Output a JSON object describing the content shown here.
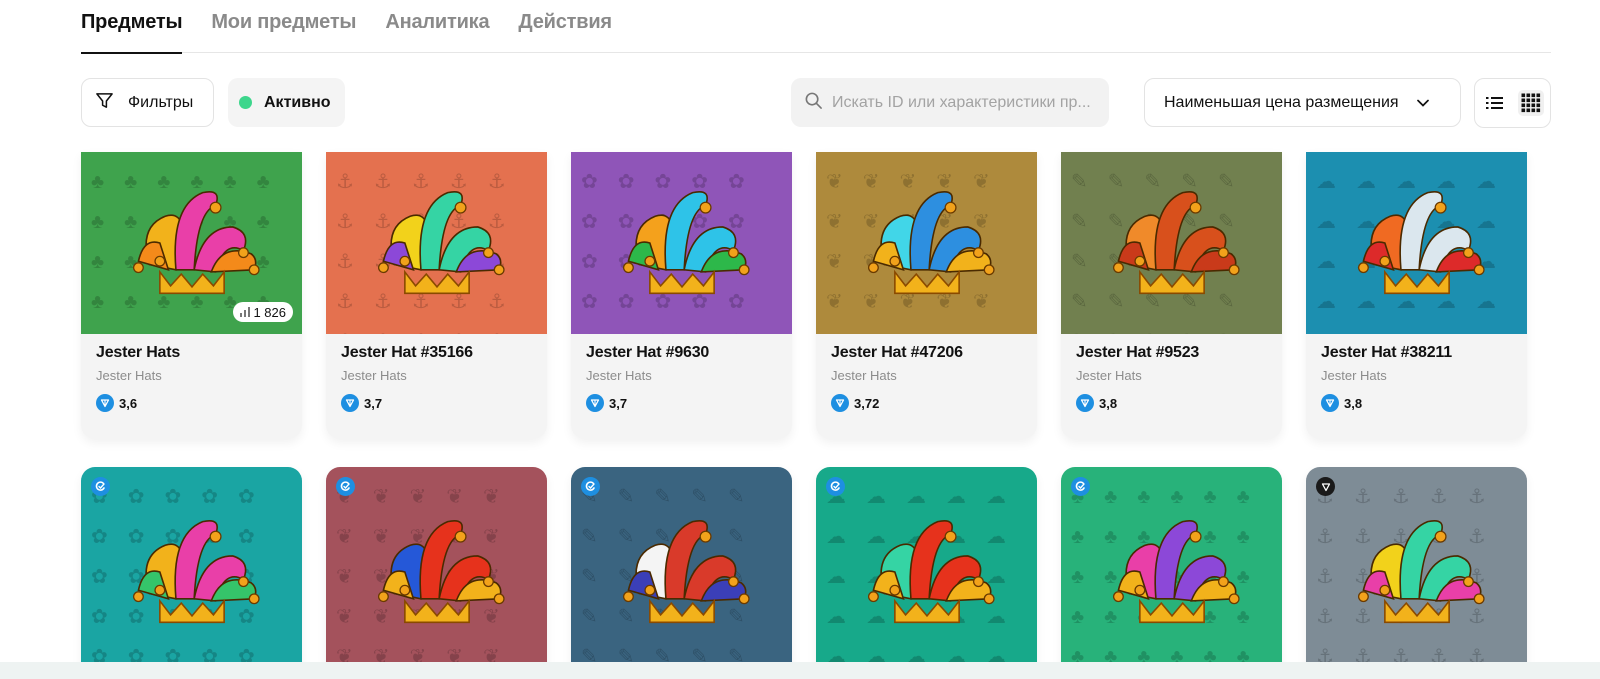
{
  "tabs": [
    {
      "label": "Предметы",
      "active": true
    },
    {
      "label": "Мои предметы",
      "active": false
    },
    {
      "label": "Аналитика",
      "active": false
    },
    {
      "label": "Действия",
      "active": false
    }
  ],
  "toolbar": {
    "filters_label": "Фильтры",
    "status_label": "Активно",
    "status_color": "#3dd68c",
    "search_placeholder": "Искать ID или характеристики пр...",
    "sort_label": "Наименьшая цена размещения",
    "view_modes": [
      "list-icon",
      "grid-icon"
    ],
    "active_view": "grid-icon"
  },
  "cards_row1": [
    {
      "title": "Jester Hats",
      "collection": "Jester Hats",
      "price": "3,6",
      "count": "1 826",
      "bg": "#3fa34d",
      "hat": [
        "#e93fa8",
        "#f2b21b",
        "#f48a1a"
      ]
    },
    {
      "title": "Jester Hat #35166",
      "collection": "Jester Hats",
      "price": "3,7",
      "bg": "#e4714f",
      "hat": [
        "#35d4a4",
        "#f2d21b",
        "#8c48d8"
      ]
    },
    {
      "title": "Jester Hat #9630",
      "collection": "Jester Hats",
      "price": "3,7",
      "bg": "#8f55b8",
      "hat": [
        "#2ec3e8",
        "#f4a11c",
        "#2db84a"
      ]
    },
    {
      "title": "Jester Hat #47206",
      "collection": "Jester Hats",
      "price": "3,72",
      "bg": "#ae8a3c",
      "hat": [
        "#2d8fe0",
        "#41d6e8",
        "#f2b21b"
      ]
    },
    {
      "title": "Jester Hat #9523",
      "collection": "Jester Hats",
      "price": "3,8",
      "bg": "#71804f",
      "hat": [
        "#d8501c",
        "#f08a2a",
        "#c93a1a"
      ]
    },
    {
      "title": "Jester Hat #38211",
      "collection": "Jester Hats",
      "price": "3,8",
      "bg": "#1c8fb0",
      "hat": [
        "#dbe7ee",
        "#f06a22",
        "#dd2a2a"
      ]
    }
  ],
  "cards_row2": [
    {
      "bg": "#1aa5a3",
      "badge": "blue",
      "hat": [
        "#e93fa8",
        "#f2b21b",
        "#35c46a"
      ]
    },
    {
      "bg": "#a4525c",
      "badge": "blue",
      "hat": [
        "#e6321c",
        "#2558d8",
        "#f2b21b"
      ]
    },
    {
      "bg": "#3a6480",
      "badge": "blue",
      "hat": [
        "#d93a2a",
        "#f4f4f4",
        "#3b3fb8"
      ]
    },
    {
      "bg": "#17a98a",
      "badge": "blue",
      "hat": [
        "#e6321c",
        "#35d4a4",
        "#f2b21b"
      ]
    },
    {
      "bg": "#28b27a",
      "badge": "blue",
      "hat": [
        "#8c48d8",
        "#e93fa8",
        "#f2b21b"
      ]
    },
    {
      "bg": "#7e8c96",
      "badge": "dark",
      "hat": [
        "#35d4a4",
        "#f2d21b",
        "#e93fa8"
      ]
    }
  ],
  "colors": {
    "accent_green": "#3dd68c",
    "ton_blue": "#1e8fe1"
  }
}
